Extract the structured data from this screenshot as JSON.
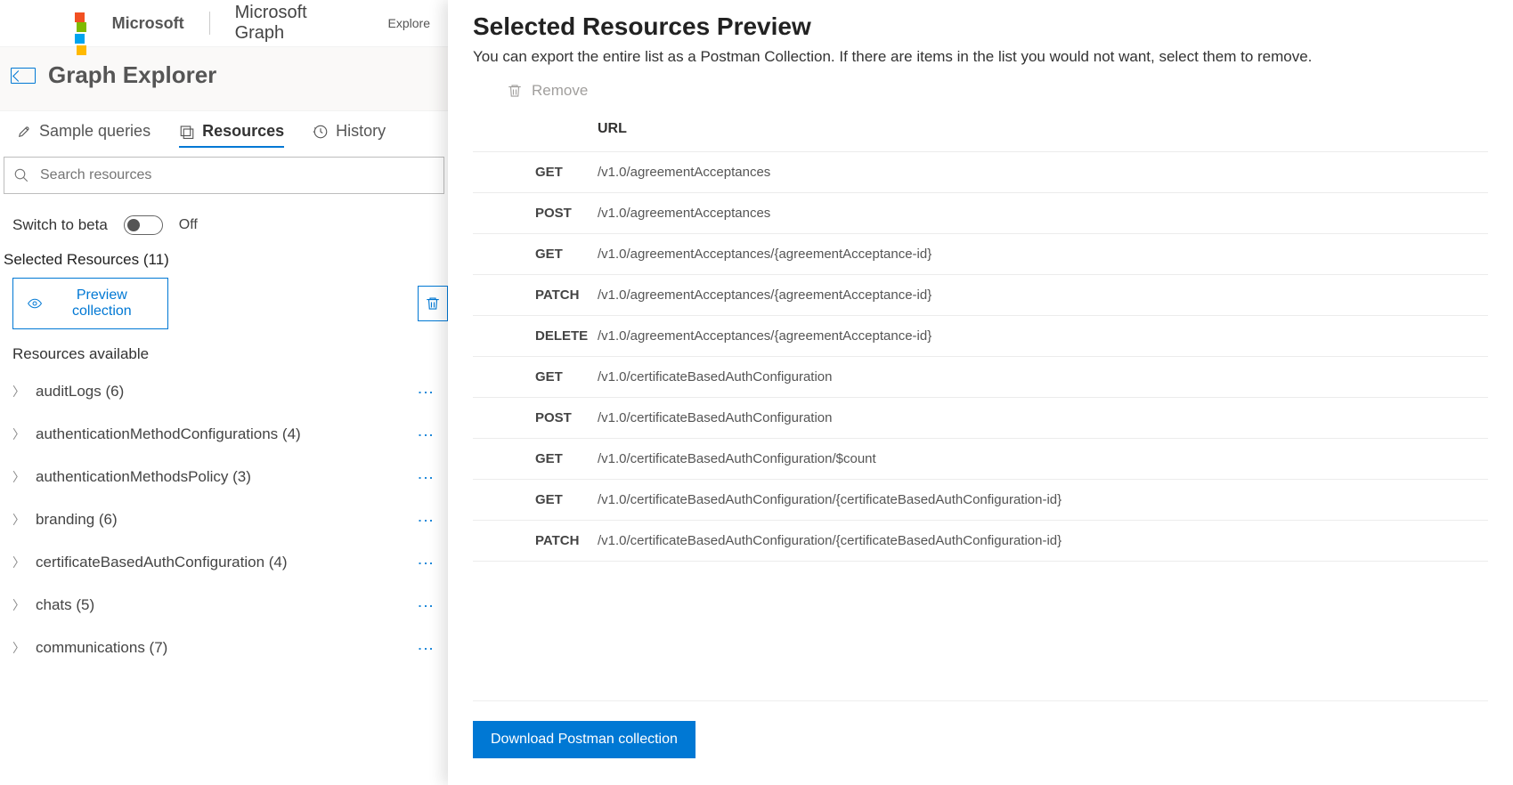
{
  "header": {
    "brand": "Microsoft",
    "product": "Microsoft Graph",
    "nav1": "Explore"
  },
  "subheader": {
    "title": "Graph Explorer"
  },
  "tabs": {
    "sample": "Sample queries",
    "resources": "Resources",
    "history": "History"
  },
  "search": {
    "placeholder": "Search resources"
  },
  "switch": {
    "label": "Switch to beta",
    "state": "Off"
  },
  "selected_label": "Selected Resources (11)",
  "preview_btn": "Preview collection",
  "res_avail": "Resources available",
  "resources": [
    {
      "name": "auditLogs",
      "count": "(6)"
    },
    {
      "name": "authenticationMethodConfigurations",
      "count": "(4)"
    },
    {
      "name": "authenticationMethodsPolicy",
      "count": "(3)"
    },
    {
      "name": "branding",
      "count": "(6)"
    },
    {
      "name": "certificateBasedAuthConfiguration",
      "count": "(4)"
    },
    {
      "name": "chats",
      "count": "(5)"
    },
    {
      "name": "communications",
      "count": "(7)"
    }
  ],
  "panel": {
    "title": "Selected Resources Preview",
    "subtitle": "You can export the entire list as a Postman Collection. If there are items in the list you would not want, select them to remove.",
    "remove": "Remove",
    "col_url": "URL",
    "download": "Download Postman collection"
  },
  "rows": [
    {
      "method": "GET",
      "url": "/v1.0/agreementAcceptances"
    },
    {
      "method": "POST",
      "url": "/v1.0/agreementAcceptances"
    },
    {
      "method": "GET",
      "url": "/v1.0/agreementAcceptances/{agreementAcceptance-id}"
    },
    {
      "method": "PATCH",
      "url": "/v1.0/agreementAcceptances/{agreementAcceptance-id}"
    },
    {
      "method": "DELETE",
      "url": "/v1.0/agreementAcceptances/{agreementAcceptance-id}"
    },
    {
      "method": "GET",
      "url": "/v1.0/certificateBasedAuthConfiguration"
    },
    {
      "method": "POST",
      "url": "/v1.0/certificateBasedAuthConfiguration"
    },
    {
      "method": "GET",
      "url": "/v1.0/certificateBasedAuthConfiguration/$count"
    },
    {
      "method": "GET",
      "url": "/v1.0/certificateBasedAuthConfiguration/{certificateBasedAuthConfiguration-id}"
    },
    {
      "method": "PATCH",
      "url": "/v1.0/certificateBasedAuthConfiguration/{certificateBasedAuthConfiguration-id}"
    }
  ]
}
